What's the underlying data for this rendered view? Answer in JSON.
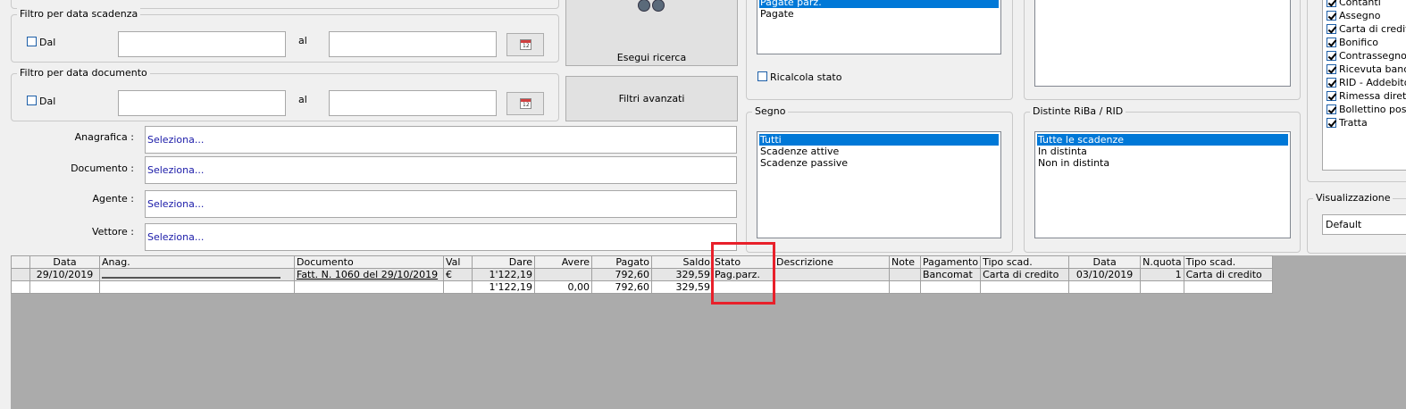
{
  "filters": {
    "scadenza": {
      "legend": "Filtro per data scadenza",
      "dal_label": "Dal",
      "al_label": "al",
      "cal_label": "12"
    },
    "documento": {
      "legend": "Filtro per data documento",
      "dal_label": "Dal",
      "al_label": "al",
      "cal_label": "12"
    }
  },
  "buttons": {
    "esegui_ricerca": "Esegui ricerca",
    "filtri_avanzati": "Filtri avanzati"
  },
  "fields": [
    {
      "label": "Anagrafica :",
      "value": "Seleziona..."
    },
    {
      "label": "Documento :",
      "value": "Seleziona..."
    },
    {
      "label": "Agente :",
      "value": "Seleziona..."
    },
    {
      "label": "Vettore :",
      "value": "Seleziona..."
    }
  ],
  "stato_list": {
    "items": [
      "Pagate parz.",
      "Pagate"
    ],
    "selected": 0,
    "ricalcola_label": "Ricalcola stato"
  },
  "segno": {
    "legend": "Segno",
    "items": [
      "Tutti",
      "Scadenze attive",
      "Scadenze passive"
    ],
    "selected": 0
  },
  "distinte": {
    "legend": "Distinte RiBa / RID",
    "items": [
      "Tutte le scadenze",
      "In distinta",
      "Non in distinta"
    ],
    "selected": 0
  },
  "pagamenti": [
    "Contanti",
    "Assegno",
    "Carta di credito",
    "Bonifico",
    "Contrassegno",
    "Ricevuta bancaria",
    "RID - Addebito",
    "Rimessa diretta",
    "Bollettino postale",
    "Tratta"
  ],
  "visualizzazione": {
    "legend": "Visualizzazione",
    "value": "Default"
  },
  "grid": {
    "columns": [
      "Data",
      "Anag.",
      "Documento",
      "Val",
      "Dare",
      "Avere",
      "Pagato",
      "Saldo",
      "Stato",
      "Descrizione",
      "Note",
      "Pagamento",
      "Tipo scad.",
      "Data",
      "N.quota",
      "Tipo scad."
    ],
    "rows": [
      [
        "29/10/2019",
        "",
        "Fatt. N. 1060 del 29/10/2019",
        "€",
        "1'122,19",
        "",
        "792,60",
        "329,59",
        "Pag.parz.",
        "",
        "",
        "Bancomat",
        "Carta di credito",
        "03/10/2019",
        "1",
        "Carta di credito"
      ],
      [
        "",
        "",
        "",
        "",
        "1'122,19",
        "0,00",
        "792,60",
        "329,59",
        "",
        "",
        "",
        "",
        "",
        "",
        "",
        ""
      ]
    ]
  }
}
